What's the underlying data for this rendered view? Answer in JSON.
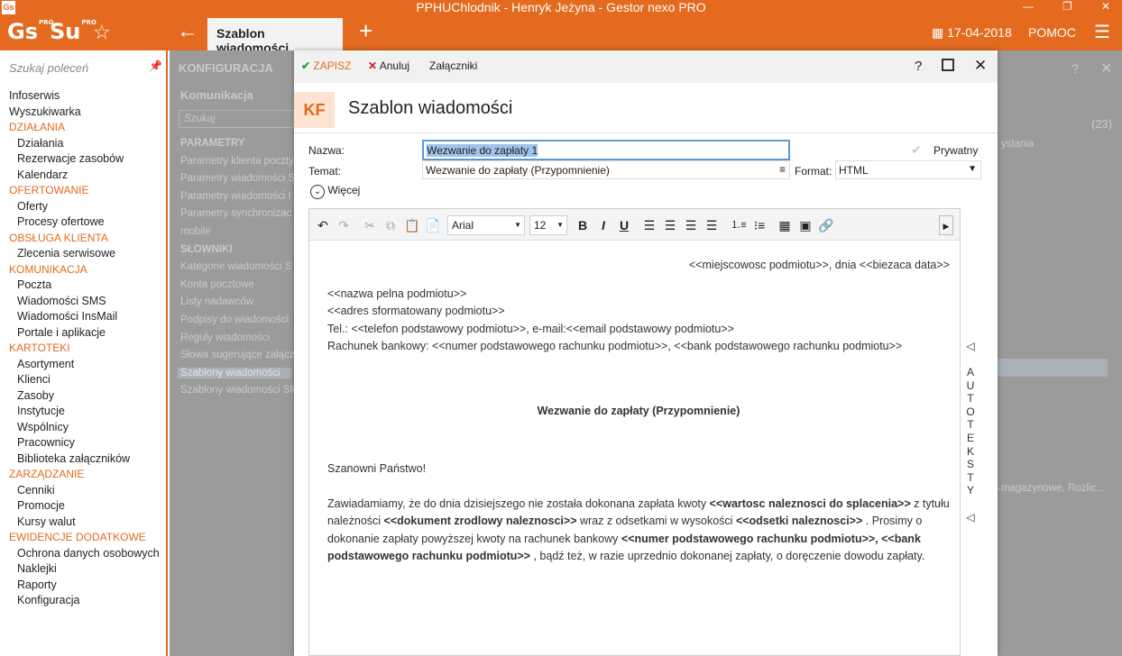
{
  "window_title": "PPHUChlodnik - Henryk Jeżyna - Gestor nexo PRO",
  "app_icon": "Gs",
  "logos": {
    "gs": "Gs",
    "su": "Su",
    "pro": "PRO"
  },
  "tab_label": "Szablon wiadomości",
  "date": "17-04-2018",
  "help_label": "POMOC",
  "search_placeholder": "Szukaj poleceń",
  "nav": [
    {
      "t": "l0",
      "label": "Infoserwis"
    },
    {
      "t": "l0",
      "label": "Wyszukiwarka"
    },
    {
      "t": "sec",
      "label": "DZIAŁANIA"
    },
    {
      "t": "l1",
      "label": "Działania"
    },
    {
      "t": "l1",
      "label": "Rezerwacje zasobów"
    },
    {
      "t": "l1",
      "label": "Kalendarz"
    },
    {
      "t": "sec",
      "label": "OFERTOWANIE"
    },
    {
      "t": "l1",
      "label": "Oferty"
    },
    {
      "t": "l1",
      "label": "Procesy ofertowe"
    },
    {
      "t": "sec",
      "label": "OBSŁUGA KLIENTA"
    },
    {
      "t": "l1",
      "label": "Zlecenia serwisowe"
    },
    {
      "t": "sec",
      "label": "KOMUNIKACJA"
    },
    {
      "t": "l1",
      "label": "Poczta"
    },
    {
      "t": "l1",
      "label": "Wiadomości SMS"
    },
    {
      "t": "l1",
      "label": "Wiadomości InsMail"
    },
    {
      "t": "l1",
      "label": "Portale i aplikacje"
    },
    {
      "t": "sec",
      "label": "KARTOTEKI"
    },
    {
      "t": "l1",
      "label": "Asortyment"
    },
    {
      "t": "l1",
      "label": "Klienci"
    },
    {
      "t": "l1",
      "label": "Zasoby"
    },
    {
      "t": "l1",
      "label": "Instytucje"
    },
    {
      "t": "l1",
      "label": "Wspólnicy"
    },
    {
      "t": "l1",
      "label": "Pracownicy"
    },
    {
      "t": "l1",
      "label": "Biblioteka załączników"
    },
    {
      "t": "sec",
      "label": "ZARZĄDZANIE"
    },
    {
      "t": "l1",
      "label": "Cenniki"
    },
    {
      "t": "l1",
      "label": "Promocje"
    },
    {
      "t": "l1",
      "label": "Kursy walut"
    },
    {
      "t": "sec",
      "label": "EWIDENCJE DODATKOWE"
    },
    {
      "t": "l1",
      "label": "Ochrona danych osobowych"
    },
    {
      "t": "l1",
      "label": "Naklejki"
    },
    {
      "t": "l1",
      "label": "Raporty"
    },
    {
      "t": "l1",
      "label": "Konfiguracja"
    }
  ],
  "background": {
    "heading": "KONFIGURACJA",
    "sub": "Komunikacja",
    "search": "Szukaj",
    "count": "(23)",
    "col": "ystania",
    "row_text": "-magazynowe, Rozlic...",
    "items": [
      "PARAMETRY",
      "Parametry klienta poczty",
      "Parametry wiadomości S",
      "Parametry wiadomości I",
      "Parametry synchronizac",
      "mobile",
      "SŁOWNIKI",
      "Kategorie wiadomości S",
      "Konta pocztowe",
      "Listy nadawców",
      "Podpisy do wiadomości",
      "Reguły wiadomości",
      "Słowa sugerujące załącz",
      "Szablony wiadomości",
      "Szablony wiadomości SM"
    ]
  },
  "toolbar": {
    "save": "ZAPISZ",
    "cancel": "Anuluj",
    "attachments": "Załączniki"
  },
  "header": {
    "badge": "KF",
    "title": "Szablon wiadomości"
  },
  "form": {
    "name_label": "Nazwa:",
    "name_value": "Wezwanie do zapłaty 1",
    "private_label": "Prywatny",
    "subject_label": "Temat:",
    "subject_value": "Wezwanie do zapłaty (Przypomnienie)",
    "format_label": "Format:",
    "format_value": "HTML",
    "more_label": "Więcej"
  },
  "editor": {
    "font": "Arial",
    "size": "12"
  },
  "doc": {
    "place_date": "<<miejscowosc podmiotu>>, dnia <<biezaca data>>",
    "addr1": "<<nazwa pelna podmiotu>>",
    "addr2": "<<adres sformatowany podmiotu>>",
    "addr3": "Tel.: <<telefon podstawowy podmiotu>>, e-mail:<<email podstawowy podmiotu>>",
    "addr4": "Rachunek bankowy: <<numer podstawowego rachunku podmiotu>>, <<bank podstawowego rachunku podmiotu>>",
    "heading": "Wezwanie do zapłaty (Przypomnienie)",
    "greeting": "Szanowni Państwo!",
    "p1": "Zawiadamiamy, że do dnia dzisiejszego nie została dokonana zapłata kwoty ",
    "b1": "<<wartosc naleznosci do splacenia>>",
    "p2": " z tytułu należności ",
    "b2": "<<dokument zrodlowy naleznosci>>",
    "p3": " wraz z odsetkami w wysokości ",
    "b3": "<<odsetki naleznosci>>",
    "p4": " . Prosimy o dokonanie zapłaty powyższej kwoty na rachunek bankowy ",
    "b4": "<<numer podstawowego rachunku podmiotu>>, <<bank podstawowego rachunku podmiotu>>",
    "p5": " , bądź też, w razie uprzednio dokonanej zapłaty, o doręczenie dowodu zapłaty."
  },
  "autoteksty": "AUTOTEKSTY"
}
